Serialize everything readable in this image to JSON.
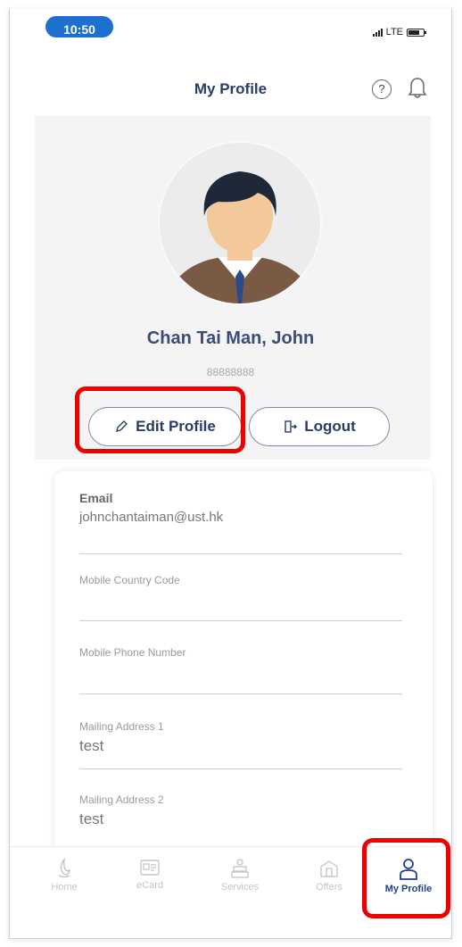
{
  "status_bar": {
    "time": "10:50",
    "network": "LTE"
  },
  "header": {
    "title": "My Profile",
    "help_symbol": "?"
  },
  "profile": {
    "name": "Chan Tai Man, John",
    "id_number": "88888888"
  },
  "actions": {
    "edit_label": "Edit Profile",
    "logout_label": "Logout"
  },
  "fields": [
    {
      "label": "Email",
      "value": "johnchantaiman@ust.hk"
    },
    {
      "label": "Mobile Country Code",
      "value": ""
    },
    {
      "label": "Mobile Phone Number",
      "value": ""
    },
    {
      "label": "Mailing Address 1",
      "value": "test"
    },
    {
      "label": "Mailing Address 2",
      "value": "test"
    }
  ],
  "tabbar": {
    "items": [
      {
        "label": "Home",
        "icon": "home-icon"
      },
      {
        "label": "eCard",
        "icon": "ecard-icon"
      },
      {
        "label": "Services",
        "icon": "services-icon"
      },
      {
        "label": "Offers",
        "icon": "offers-icon"
      },
      {
        "label": "My Profile",
        "icon": "profile-icon",
        "active": true
      }
    ]
  },
  "colors": {
    "accent": "#1e3f8c",
    "status_time_bg": "#1d6fd0",
    "highlight": "#ee0000"
  }
}
